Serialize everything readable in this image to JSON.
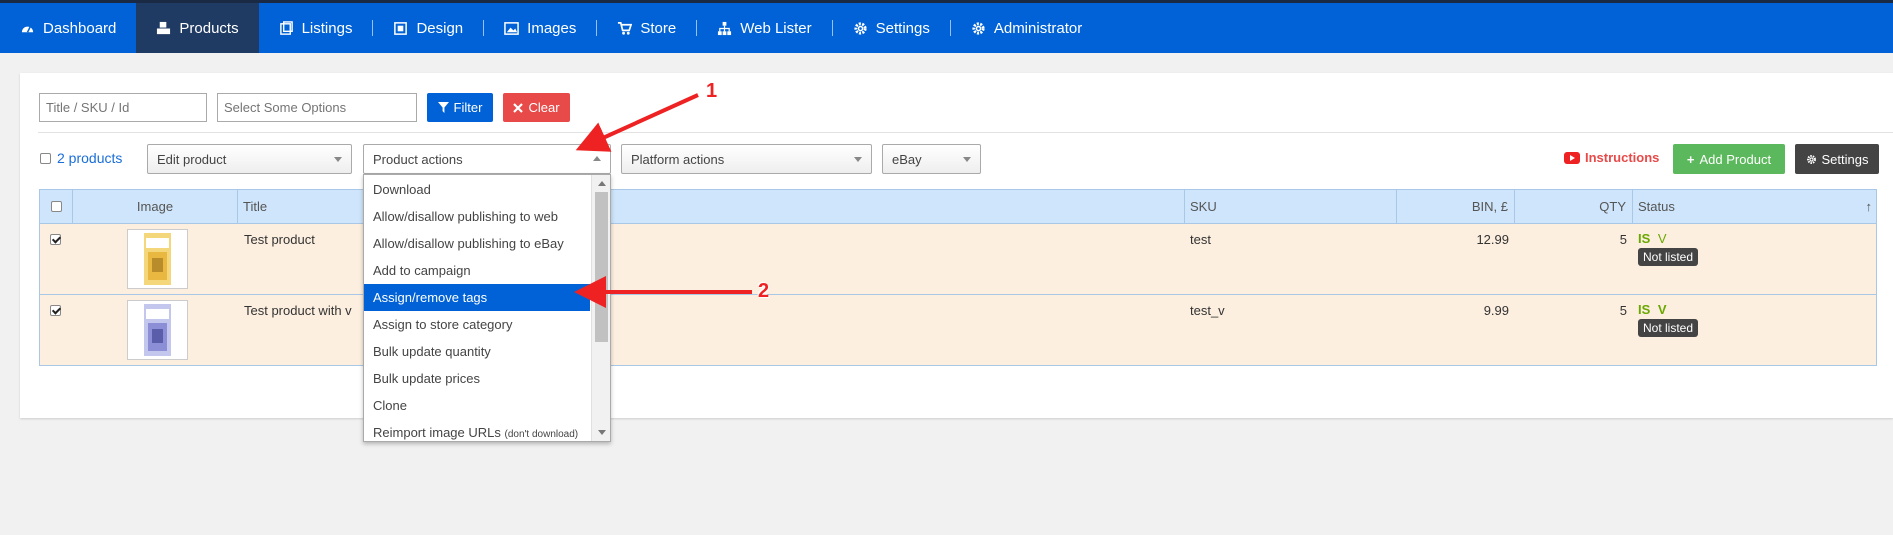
{
  "nav": {
    "items": [
      {
        "label": "Dashboard",
        "icon": "dashboard-icon"
      },
      {
        "label": "Products",
        "icon": "cubes-icon"
      },
      {
        "label": "Listings",
        "icon": "listings-icon"
      },
      {
        "label": "Design",
        "icon": "design-icon"
      },
      {
        "label": "Images",
        "icon": "image-icon"
      },
      {
        "label": "Store",
        "icon": "cart-icon"
      },
      {
        "label": "Web Lister",
        "icon": "sitemap-icon"
      },
      {
        "label": "Settings",
        "icon": "gear-icon"
      },
      {
        "label": "Administrator",
        "icon": "gear-icon"
      }
    ]
  },
  "filter": {
    "title_placeholder": "Title / SKU / Id",
    "options_placeholder": "Select Some Options",
    "filter_label": "Filter",
    "clear_label": "Clear"
  },
  "toolbar": {
    "count_label": "2 products",
    "edit_select": "Edit product",
    "product_actions_select": "Product actions",
    "platform_actions_select": "Platform actions",
    "platform_select": "eBay",
    "instructions_label": "Instructions",
    "add_product_label": "Add Product",
    "settings_label": "Settings"
  },
  "table": {
    "headers": {
      "image": "Image",
      "title": "Title",
      "sku": "SKU",
      "bin": "BIN, £",
      "qty": "QTY",
      "status": "Status",
      "sort": "↑"
    },
    "rows": [
      {
        "title": "Test product",
        "sku": "test",
        "bin": "12.99",
        "qty": "5",
        "is": "IS",
        "v": "V",
        "badge": "Not listed"
      },
      {
        "title": "Test product with v",
        "sku": "test_v",
        "bin": "9.99",
        "qty": "5",
        "is": "IS",
        "v": "V",
        "badge": "Not listed"
      }
    ]
  },
  "dropdown": {
    "items": [
      "Download",
      "Allow/disallow publishing to web",
      "Allow/disallow publishing to eBay",
      "Add to campaign",
      "Assign/remove tags",
      "Assign to store category",
      "Bulk update quantity",
      "Bulk update prices",
      "Clone",
      "Reimport image URLs"
    ],
    "reimport_note": "(don't download)",
    "selected_index": 4
  },
  "annotations": {
    "one": "1",
    "two": "2"
  },
  "colors": {
    "nav_blue": "#0062d6",
    "active_nav": "#1f3a63",
    "green": "#5cb85c",
    "red": "#e84a4a",
    "dark": "#444444",
    "accent_red": "#e22222"
  }
}
